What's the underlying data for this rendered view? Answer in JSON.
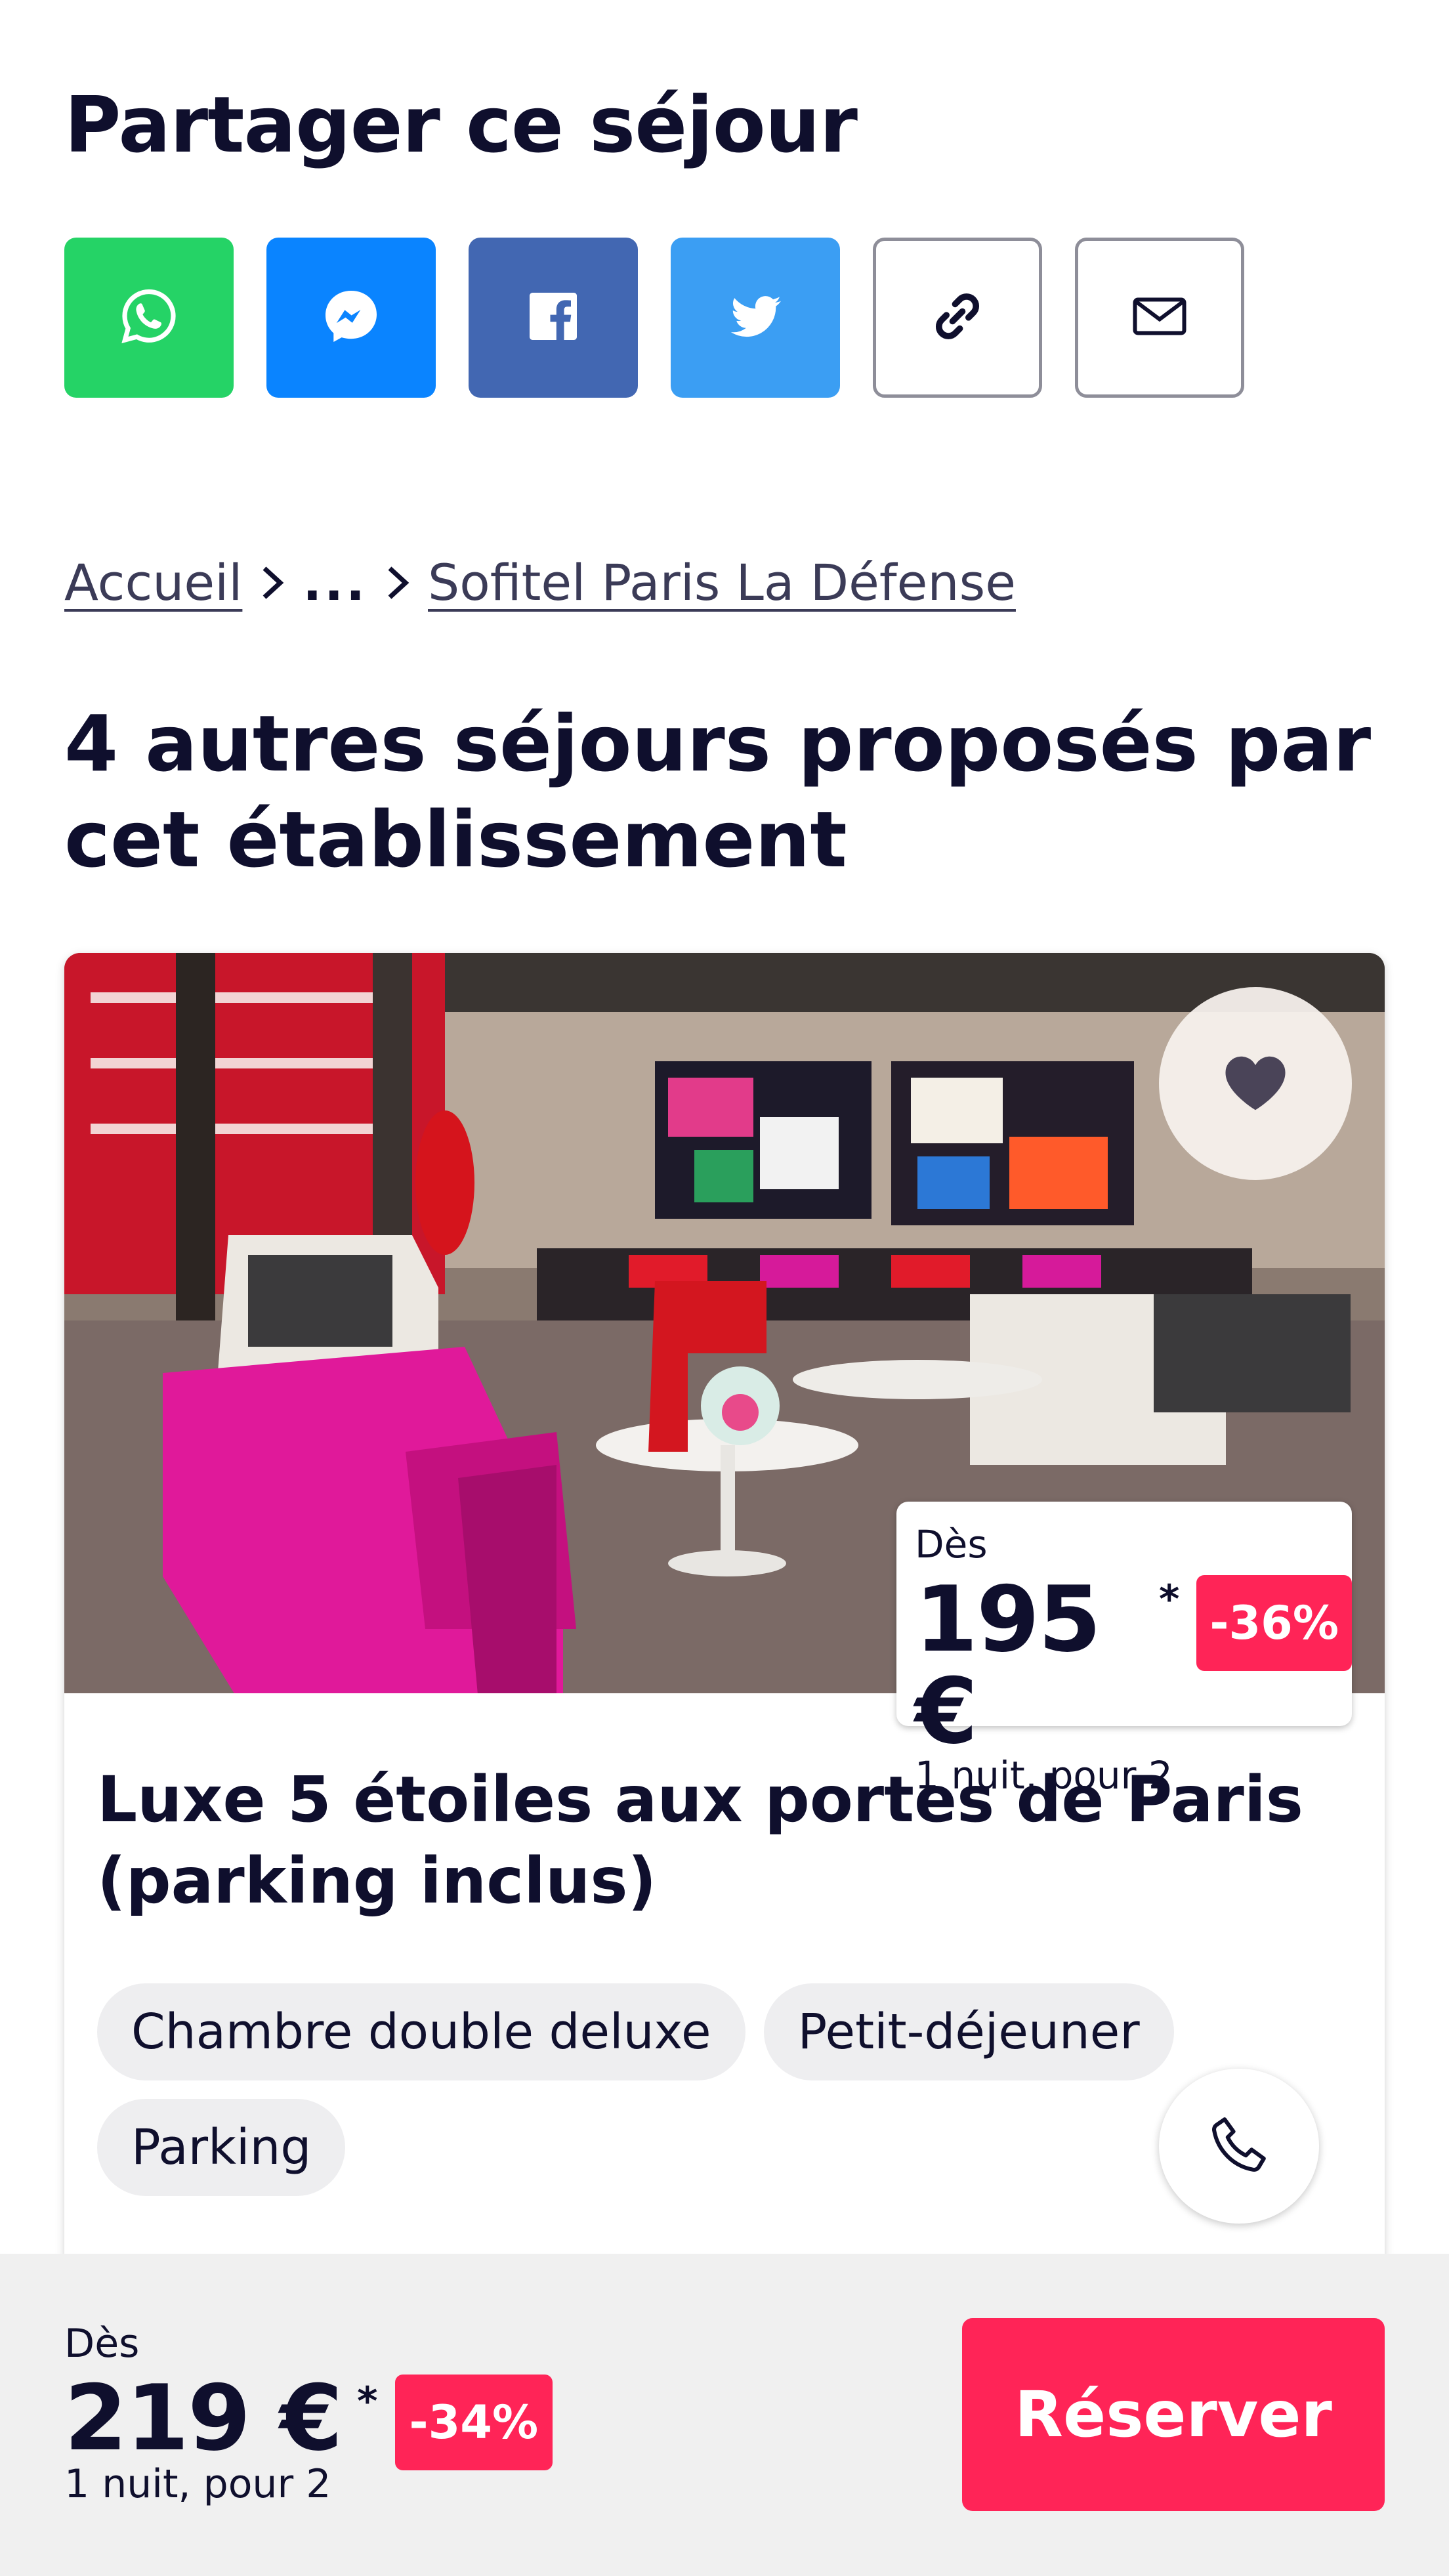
{
  "share": {
    "title": "Partager ce séjour",
    "buttons": [
      {
        "name": "whatsapp",
        "icon": "whatsapp-icon",
        "color": "#25d366"
      },
      {
        "name": "messenger",
        "icon": "messenger-icon",
        "color": "#0a84ff"
      },
      {
        "name": "facebook",
        "icon": "facebook-icon",
        "color": "#4267b2"
      },
      {
        "name": "twitter",
        "icon": "twitter-icon",
        "color": "#3b9ef3"
      },
      {
        "name": "copy-link",
        "icon": "link-icon",
        "color": "#ffffff"
      },
      {
        "name": "email",
        "icon": "mail-icon",
        "color": "#ffffff"
      }
    ]
  },
  "breadcrumb": {
    "home": "Accueil",
    "ellipsis": "...",
    "current": "Sofitel Paris La Défense"
  },
  "other_stays": {
    "title": "4 autres séjours proposés par cet établissement"
  },
  "card": {
    "price_from": "Dès",
    "price": "195 €",
    "price_asterisk": "*",
    "discount": "-36%",
    "price_detail": "1 nuit, pour 2",
    "title": "Luxe 5 étoiles aux portes de Paris (parking inclus)",
    "tags": [
      "Chambre double deluxe",
      "Petit-déjeuner",
      "Parking"
    ],
    "favorite_icon": "heart-icon",
    "phone_icon": "phone-icon"
  },
  "bottom_bar": {
    "price_from": "Dès",
    "price": "219 €",
    "price_asterisk": "*",
    "discount": "-34%",
    "price_detail": "1 nuit, pour 2",
    "reserve_label": "Réserver"
  },
  "colors": {
    "accent": "#ff2457",
    "text": "#0f0f2d"
  }
}
